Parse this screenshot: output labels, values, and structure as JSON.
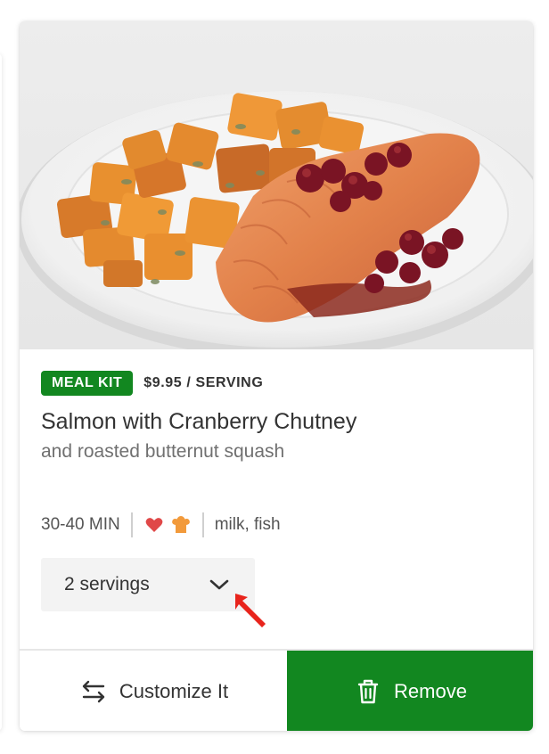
{
  "card": {
    "badge": "MEAL KIT",
    "price": "$9.95 / SERVING",
    "title": "Salmon with Cranberry Chutney",
    "subtitle": "and roasted butternut squash",
    "time": "30-40 MIN",
    "allergens": "milk, fish",
    "servings_selected": "2 servings",
    "customize_label": "Customize It",
    "remove_label": "Remove",
    "icons": {
      "heart": "heart-icon",
      "chef": "chef-hat-icon",
      "chevron": "chevron-down-icon",
      "swap": "swap-arrows-icon",
      "trash": "trash-icon"
    }
  },
  "colors": {
    "accent": "#128720",
    "heart": "#e04848",
    "chef": "#f29a3b",
    "annotation_arrow": "#e8241c"
  }
}
